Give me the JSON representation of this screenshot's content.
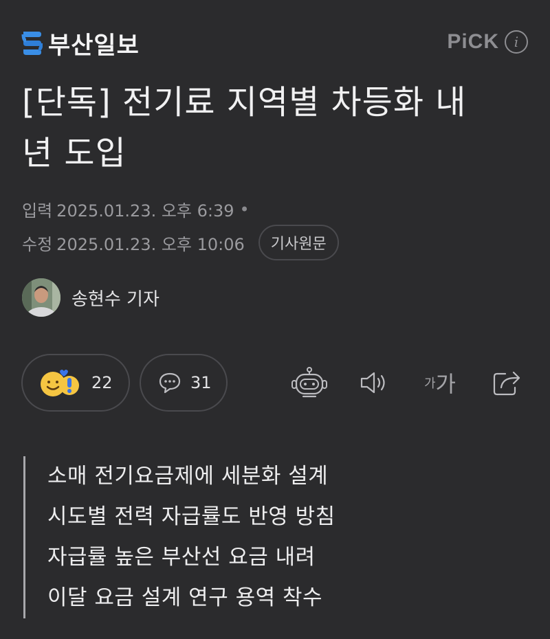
{
  "header": {
    "brand_name": "부산일보",
    "brand_color": "#3a8ee6",
    "pick_label": "PiCK",
    "info_icon": "i"
  },
  "article": {
    "title_line1": "[단독] 전기료 지역별 차등화 내",
    "title_line2": "년 도입",
    "published_label": "입력",
    "published_value": "2025.01.23. 오후 6:39",
    "separator": "•",
    "modified_label": "수정",
    "modified_value": "2025.01.23. 오후 10:06",
    "source_button": "기사원문"
  },
  "reporter": {
    "name": "송현수 기자"
  },
  "actions": {
    "reaction_count": "22",
    "comment_count": "31",
    "font_small": "가",
    "font_big": "가"
  },
  "summary": [
    "소매 전기요금제에 세분화 설계",
    "시도별 전력 자급률도 반영 방침",
    "자급률 높은 부산선 요금 내려",
    "이달 요금 설계 연구 용역 착수"
  ]
}
